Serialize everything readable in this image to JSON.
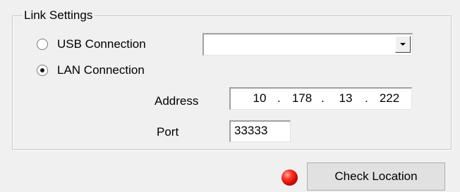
{
  "link_settings": {
    "group_title": "Link Settings",
    "usb_option": {
      "label": "USB Connection",
      "checked": false
    },
    "usb_device_select": {
      "value": ""
    },
    "lan_option": {
      "label": "LAN Connection",
      "checked": true
    },
    "address": {
      "label": "Address",
      "octets": [
        "10",
        "178",
        "13",
        "222"
      ],
      "separator": "."
    },
    "port": {
      "label": "Port",
      "value": "33333"
    }
  },
  "footer": {
    "status_indicator_color": "#d00f0a",
    "check_location_label": "Check Location"
  }
}
